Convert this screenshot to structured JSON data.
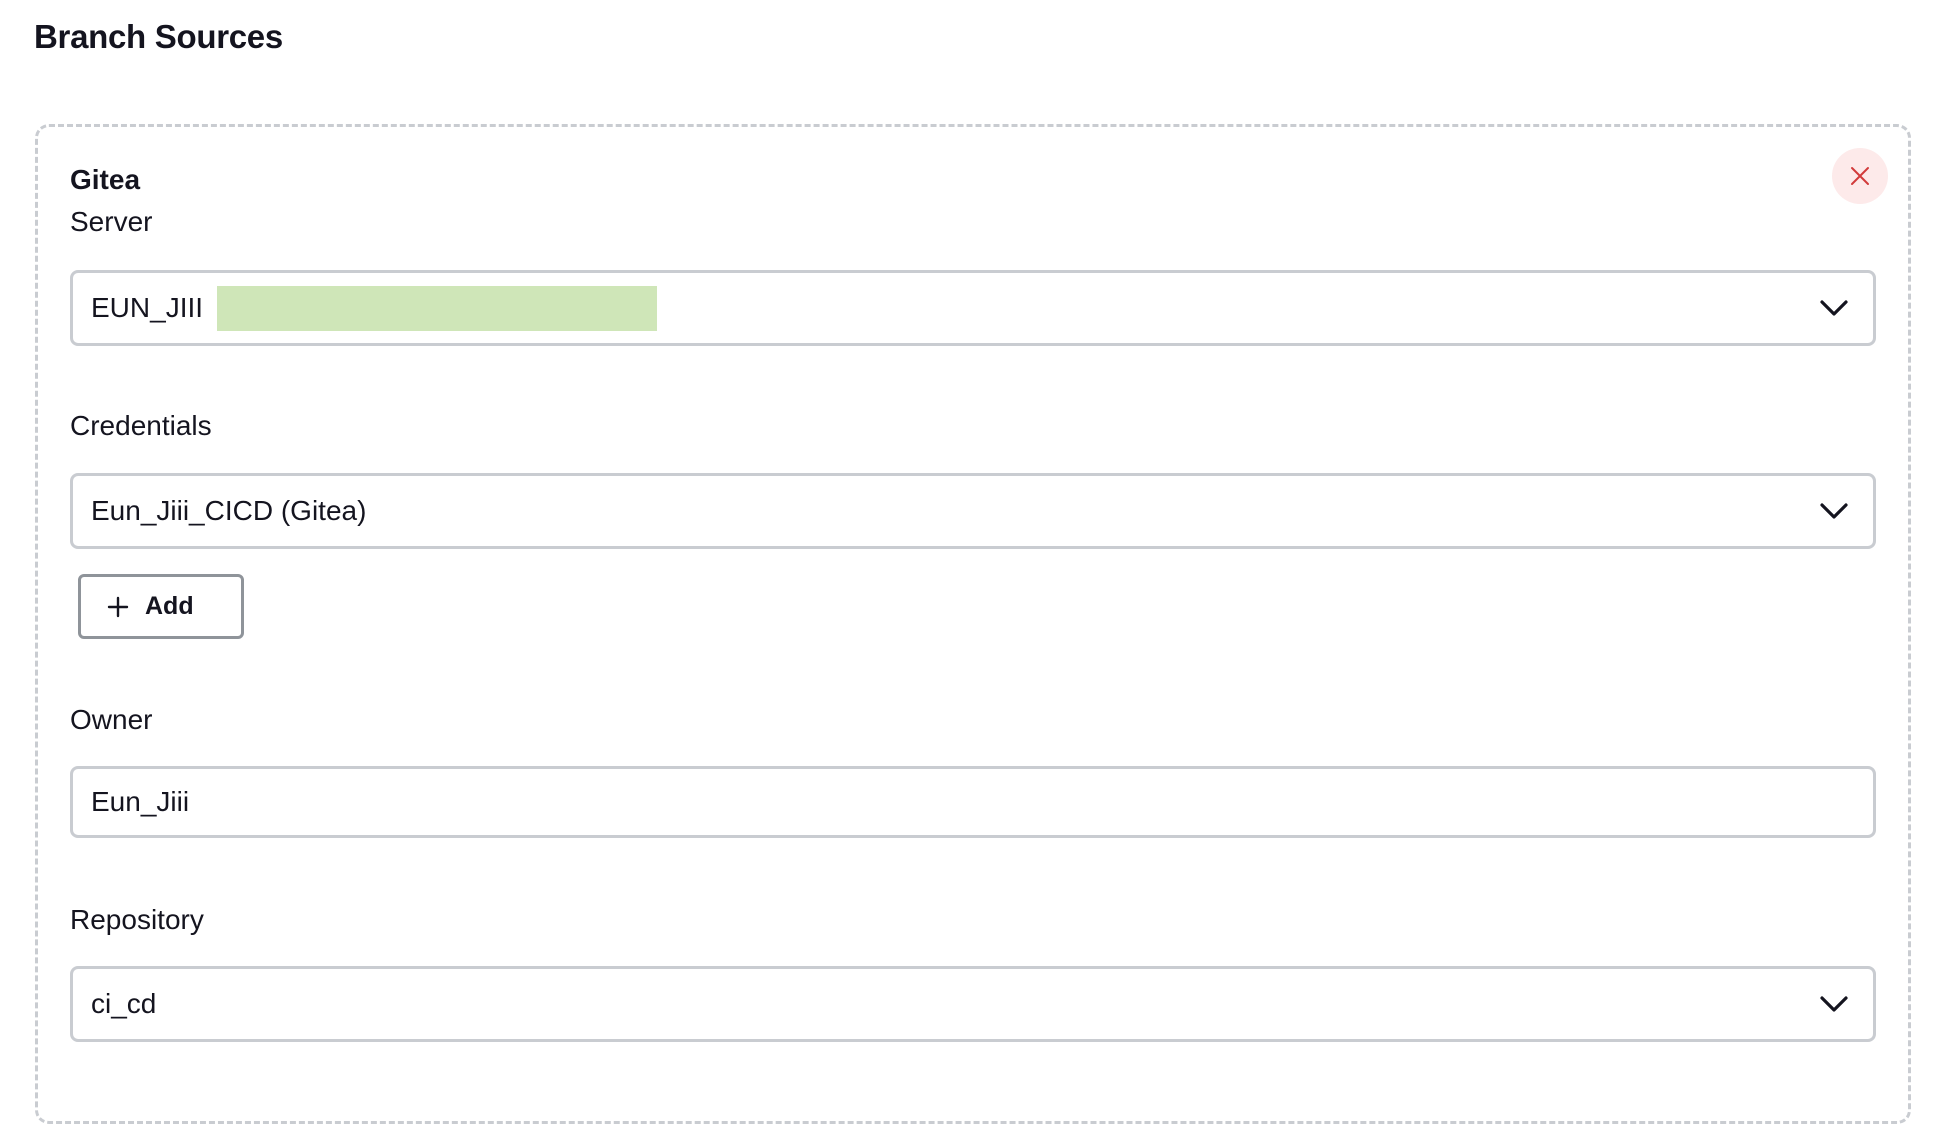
{
  "page": {
    "title": "Branch Sources"
  },
  "source": {
    "type_label": "Gitea",
    "close_icon": "close-icon",
    "server": {
      "label": "Server",
      "value": "EUN_JIII"
    },
    "credentials": {
      "label": "Credentials",
      "value": "Eun_Jiii_CICD (Gitea)",
      "add_label": "Add",
      "add_icon": "plus-icon"
    },
    "owner": {
      "label": "Owner",
      "value": "Eun_Jiii"
    },
    "repository": {
      "label": "Repository",
      "value": "ci_cd"
    }
  },
  "colors": {
    "close_icon": "#d23b3b",
    "close_bg": "#fdeaea",
    "border": "#c9ccd1",
    "redaction": "#cfe6b8"
  }
}
